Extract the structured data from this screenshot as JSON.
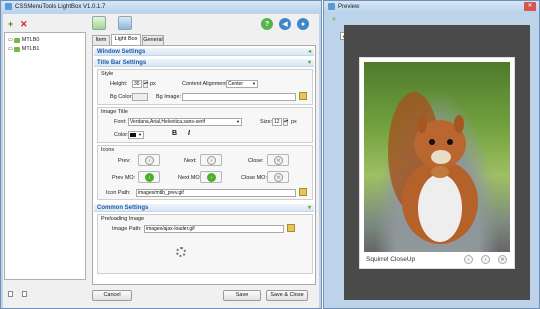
{
  "main_window": {
    "title": "CSSMenuTools LightBox V1.0.1.7",
    "tabs": [
      "Item",
      "Light Box",
      "General"
    ],
    "tree": [
      {
        "label": "MTLB0"
      },
      {
        "label": "MTLB1"
      }
    ],
    "sections": {
      "window_settings": "Window Settings",
      "title_bar_settings": "Title Bar Settings",
      "common_settings": "Common Settings"
    },
    "style": {
      "header": "Style",
      "height_label": "Height:",
      "height_value": "35",
      "height_unit": "px",
      "content_alignment_label": "Content Alignment:",
      "content_alignment_value": "Center",
      "bg_color_label": "Bg Color:",
      "bg_image_label": "Bg Image:"
    },
    "image_title": {
      "header": "Image Title",
      "font_label": "Font:",
      "font_value": "Verdana,Arial,Helvetica,sans-serif",
      "size_label": "Size:",
      "size_value": "12",
      "size_unit": "px",
      "color_label": "Color:",
      "bold": "B",
      "italic": "I"
    },
    "icons": {
      "header": "Icons",
      "prev_label": "Prev:",
      "next_label": "Next:",
      "close_label": "Close:",
      "prev_mo_label": "Prev MO:",
      "next_mo_label": "Next MO:",
      "close_mo_label": "Close MO:",
      "icon_path_label": "Icon Path:",
      "icon_path_value": "images/mtlb_prev.gif"
    },
    "preloading": {
      "header": "Preloading Image",
      "image_path_label": "Image Path:",
      "image_path_value": "images/ajax-loader.gif"
    },
    "buttons": {
      "cancel": "Cancel",
      "save": "Save",
      "save_close": "Save & Close"
    }
  },
  "preview_window": {
    "title": "Preview",
    "caption": "Squirrel CloseUp"
  },
  "colors": {
    "accent_green": "#4caf2a",
    "section_blue": "#1e5aa8",
    "preview_bg": "#4a4a4a"
  }
}
